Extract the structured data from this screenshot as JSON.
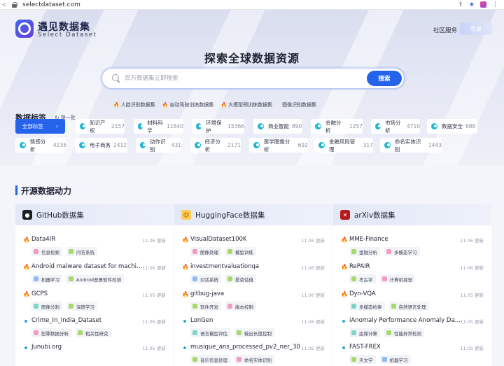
{
  "browser": {
    "url": "selectdataset.com"
  },
  "header": {
    "logo_cn": "遇见数据集",
    "logo_en": "Select Dataset",
    "nav_community": "社区服务",
    "login": "登录"
  },
  "hero": {
    "title": "探索全球数据资源",
    "search_placeholder": "百万数据集立即搜索",
    "search_button": "搜索",
    "hot": [
      "人脸识别数据集",
      "自动驾驶训练数据集",
      "大模型预训练数据集"
    ],
    "hot_plain": "图像识别数据集"
  },
  "tags": {
    "title": "数据标签",
    "refresh": "换一批",
    "all": "全部标签",
    "row1": [
      {
        "label": "知识产权",
        "count": "2157"
      },
      {
        "label": "材料科学",
        "count": "11640"
      },
      {
        "label": "环境保护",
        "count": "15366"
      },
      {
        "label": "商业智能",
        "count": "890"
      },
      {
        "label": "金融分析",
        "count": "1257"
      },
      {
        "label": "市场分析",
        "count": "4710"
      },
      {
        "label": "数据安全",
        "count": "688"
      }
    ],
    "row2": [
      {
        "label": "情感分析",
        "count": "4235"
      },
      {
        "label": "电子商务",
        "count": "2412"
      },
      {
        "label": "动作识别",
        "count": "431"
      },
      {
        "label": "经济分析",
        "count": "2171"
      },
      {
        "label": "医学图像分析",
        "count": "692"
      },
      {
        "label": "金融风险管理",
        "count": "317"
      },
      {
        "label": "命名实体识别",
        "count": "1443"
      }
    ]
  },
  "section": {
    "title": "开源数据动力",
    "panels": [
      {
        "name": "GitHub数据集",
        "items": [
          {
            "title": "Data4IR",
            "date": "11.06 更新",
            "hot": true,
            "tags": [
              "信息检索",
              "问答系统"
            ]
          },
          {
            "title": "Android malware dataset for machine ...",
            "date": "11.06 更新",
            "hot": true,
            "tags": [
              "机器学习",
              "Android恶意软件检测"
            ]
          },
          {
            "title": "GCPS",
            "date": "11.05 更新",
            "hot": true,
            "tags": [
              "图像分割",
              "深度学习"
            ]
          },
          {
            "title": "Crime_In_India_Dataset",
            "date": "11.05 更新",
            "hot": false,
            "tags": [
              "犯罪数据分析",
              "相关性研究"
            ]
          },
          {
            "title": "Junubi.org",
            "date": "11.05 更新",
            "hot": false,
            "tags": []
          }
        ]
      },
      {
        "name": "HuggingFace数据集",
        "items": [
          {
            "title": "VisualDataset100K",
            "date": "11.06 更新",
            "hot": true,
            "tags": [
              "图像处理",
              "模型训练"
            ]
          },
          {
            "title": "investmentvaluationqa",
            "date": "11.06 更新",
            "hot": true,
            "tags": [
              "对话系统",
              "投资估值"
            ]
          },
          {
            "title": "gitbug-java",
            "date": "11.06 更新",
            "hot": true,
            "tags": [
              "软件开发",
              "版本控制"
            ]
          },
          {
            "title": "LonGen",
            "date": "11.06 更新",
            "hot": false,
            "tags": [
              "语言模型评估",
              "输出长度控制"
            ]
          },
          {
            "title": "musique_ans_processed_pv2_ner_30",
            "date": "11.06 更新",
            "hot": false,
            "tags": [
              "音乐信息处理",
              "命名实体识别"
            ]
          }
        ]
      },
      {
        "name": "arXiv数据集",
        "items": [
          {
            "title": "MME-Finance",
            "date": "11.06 更新",
            "hot": true,
            "tags": [
              "金融分析",
              "多模态学习"
            ]
          },
          {
            "title": "RePAIR",
            "date": "11.06 更新",
            "hot": true,
            "tags": [
              "考古学",
              "计算机视觉"
            ]
          },
          {
            "title": "Dyn-VQA",
            "date": "11.05 更新",
            "hot": true,
            "tags": [
              "多模态检索",
              "自然语言处理"
            ]
          },
          {
            "title": "iAnomaly Performance Anomaly Dataset",
            "date": "11.05 更新",
            "hot": false,
            "tags": [
              "边缘计算",
              "性能异常检测"
            ]
          },
          {
            "title": "FAST-FREX",
            "date": "11.05 更新",
            "hot": false,
            "tags": [
              "天文学",
              "机器学习"
            ]
          }
        ]
      }
    ]
  }
}
